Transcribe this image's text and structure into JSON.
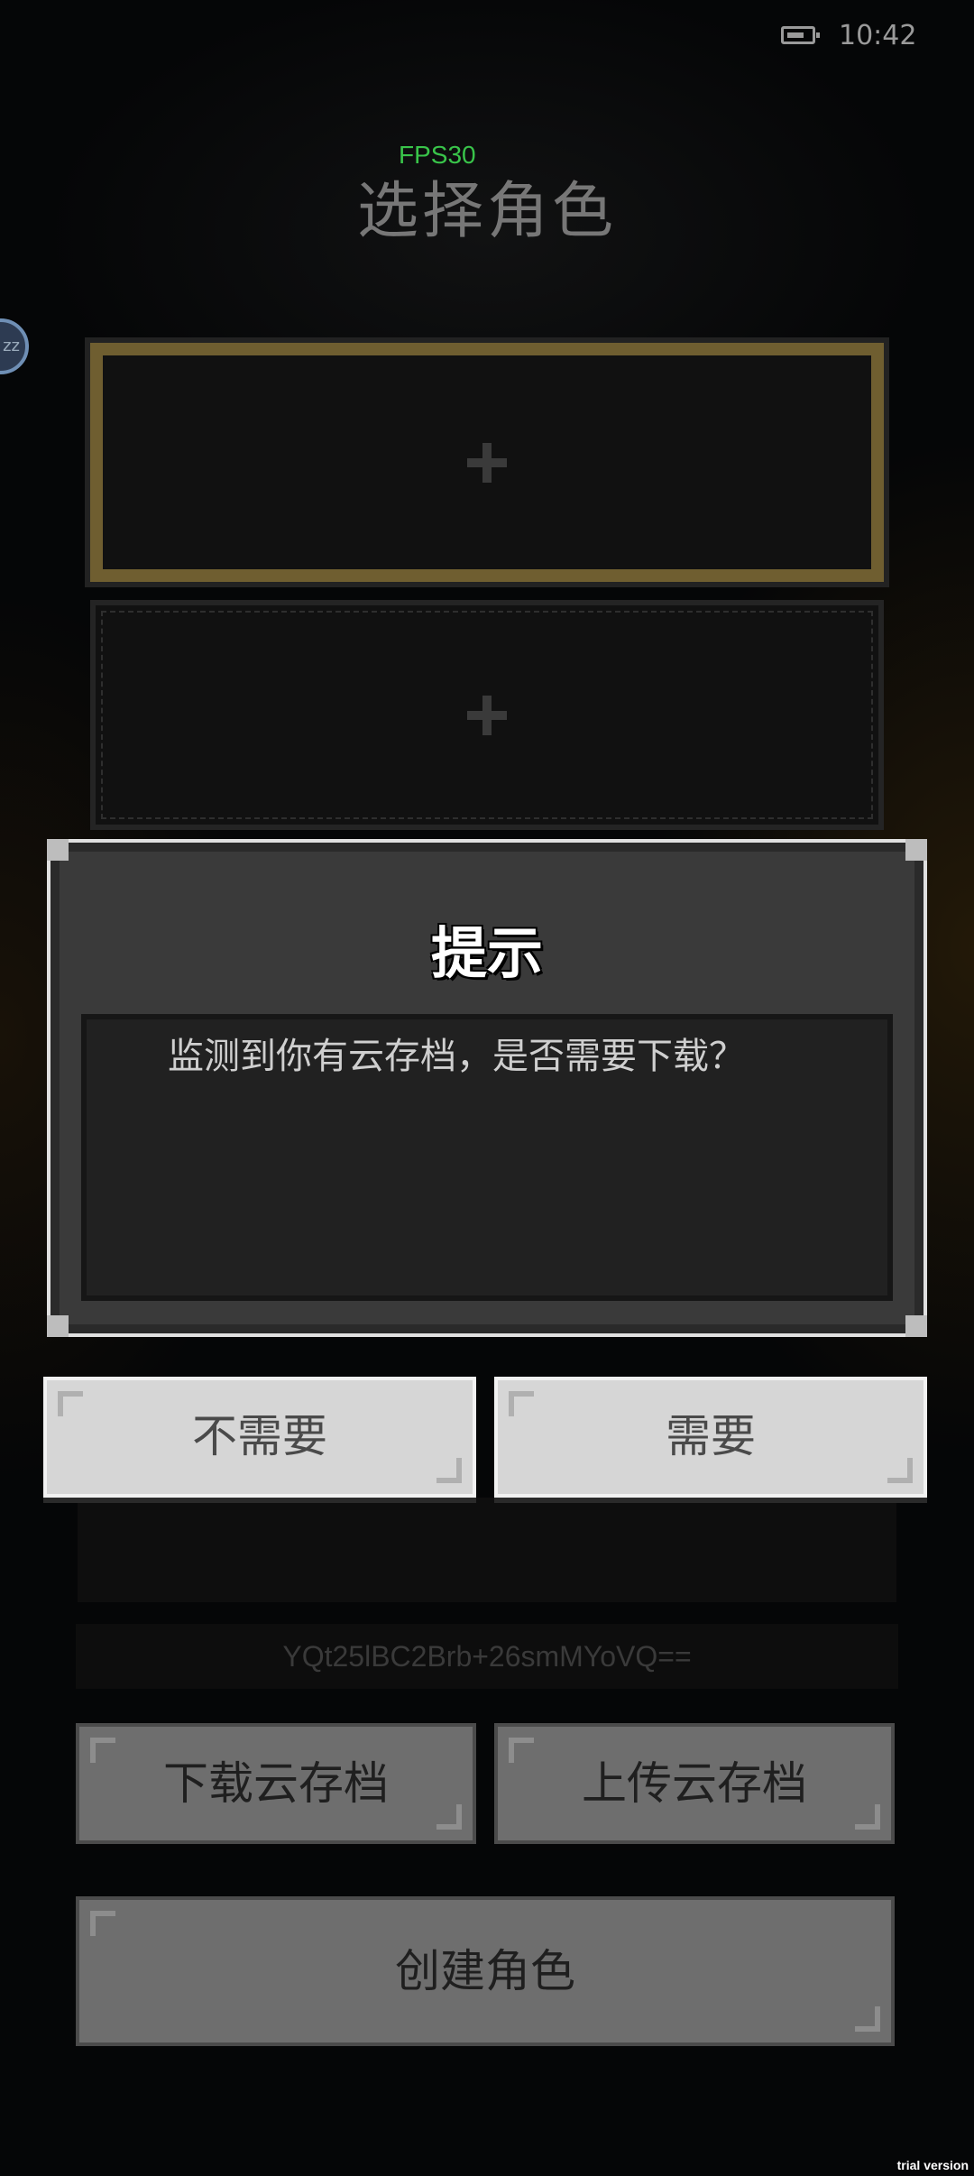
{
  "status_bar": {
    "time": "10:42"
  },
  "fps": "FPS30",
  "page_title": "选择角色",
  "bubble_label": "zz",
  "cloud_id": "YQt25lBC2Brb+26smMYoVQ==",
  "buttons": {
    "download_cloud": "下载云存档",
    "upload_cloud": "上传云存档",
    "create_role": "创建角色"
  },
  "dialog": {
    "title": "提示",
    "message": "监测到你有云存档，是否需要下载？",
    "no_label": "不需要",
    "yes_label": "需要"
  },
  "watermark": "trial version"
}
